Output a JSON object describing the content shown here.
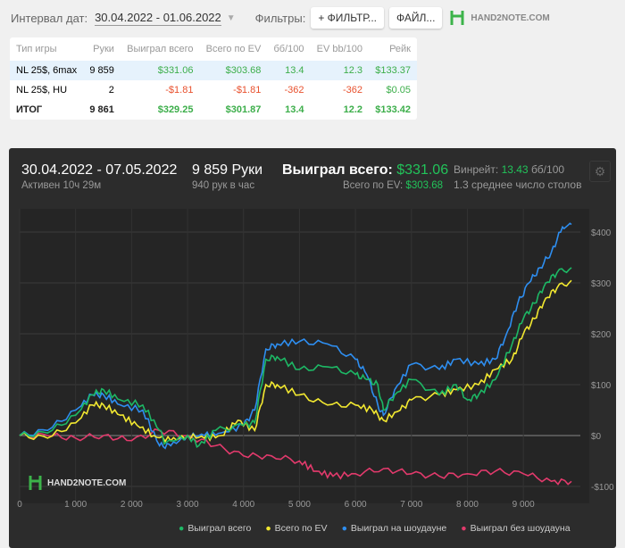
{
  "toolbar": {
    "interval_label": "Интервал дат:",
    "date_range": "30.04.2022 - 01.06.2022",
    "filters_label": "Фильтры:",
    "filter_button": "+ ФИЛЬТР...",
    "file_button": "ФАЙЛ...",
    "logo_text": "HAND2NOTE.COM"
  },
  "table": {
    "headers": [
      "Тип игры",
      "Руки",
      "Выиграл всего",
      "Всего по EV",
      "бб/100",
      "EV bb/100",
      "Рейк"
    ],
    "rows": [
      [
        "NL 25$, 6max",
        "9 859",
        "$331.06",
        "$303.68",
        "13.4",
        "12.3",
        "$133.37"
      ],
      [
        "NL 25$, HU",
        "2",
        "-$1.81",
        "-$1.81",
        "-362",
        "-362",
        "$0.05"
      ],
      [
        "ИТОГ",
        "9 861",
        "$329.25",
        "$301.87",
        "13.4",
        "12.2",
        "$133.42"
      ]
    ]
  },
  "summary": {
    "period": "30.04.2022 - 07.05.2022",
    "active": "Активен 10ч 29м",
    "hands": "9 859 Руки",
    "hands_per_hour": "940 рук в час",
    "won_label": "Выиграл всего:",
    "won_value": "$331.06",
    "ev_label": "Всего по EV:",
    "ev_value": "$303.68",
    "winrate_label": "Винрейт:",
    "winrate_value": "13.43",
    "winrate_unit": "бб/100",
    "tables": "1.3 среднее число столов",
    "watermark": "HAND2NOTE.COM"
  },
  "chart_data": {
    "type": "line",
    "xlim": [
      0,
      9859
    ],
    "ylim": [
      -120,
      440
    ],
    "x_ticks": [
      0,
      1000,
      2000,
      3000,
      4000,
      5000,
      6000,
      7000,
      8000,
      9000
    ],
    "x_tick_labels": [
      "0",
      "1 000",
      "2 000",
      "3 000",
      "4 000",
      "5 000",
      "6 000",
      "7 000",
      "8 000",
      "9 000"
    ],
    "y_ticks": [
      -100,
      0,
      100,
      200,
      300,
      400
    ],
    "y_tick_labels": [
      "-$100",
      "$0",
      "$100",
      "$200",
      "$300",
      "$400"
    ],
    "legend_position": "bottom",
    "series": [
      {
        "name": "Выиграл всего",
        "color": "#1db865",
        "points": [
          [
            0,
            0
          ],
          [
            500,
            5
          ],
          [
            1000,
            40
          ],
          [
            1300,
            80
          ],
          [
            1500,
            90
          ],
          [
            1800,
            70
          ],
          [
            2200,
            60
          ],
          [
            2500,
            10
          ],
          [
            2600,
            -15
          ],
          [
            3000,
            0
          ],
          [
            3200,
            -20
          ],
          [
            3500,
            10
          ],
          [
            4000,
            20
          ],
          [
            4200,
            25
          ],
          [
            4400,
            150
          ],
          [
            4600,
            155
          ],
          [
            5000,
            130
          ],
          [
            5500,
            135
          ],
          [
            6000,
            120
          ],
          [
            6200,
            110
          ],
          [
            6400,
            100
          ],
          [
            6500,
            50
          ],
          [
            6700,
            80
          ],
          [
            7000,
            110
          ],
          [
            7500,
            80
          ],
          [
            7800,
            100
          ],
          [
            8000,
            70
          ],
          [
            8200,
            80
          ],
          [
            8500,
            110
          ],
          [
            8800,
            180
          ],
          [
            9000,
            230
          ],
          [
            9200,
            260
          ],
          [
            9400,
            300
          ],
          [
            9600,
            320
          ],
          [
            9859,
            330
          ]
        ]
      },
      {
        "name": "Всего по EV",
        "color": "#f2e830",
        "points": [
          [
            0,
            0
          ],
          [
            500,
            -5
          ],
          [
            1000,
            25
          ],
          [
            1300,
            60
          ],
          [
            1500,
            60
          ],
          [
            1800,
            40
          ],
          [
            2100,
            20
          ],
          [
            2400,
            0
          ],
          [
            2700,
            -10
          ],
          [
            3000,
            0
          ],
          [
            3300,
            -5
          ],
          [
            3600,
            0
          ],
          [
            3900,
            30
          ],
          [
            4200,
            10
          ],
          [
            4400,
            100
          ],
          [
            4600,
            100
          ],
          [
            5000,
            80
          ],
          [
            5500,
            60
          ],
          [
            6000,
            60
          ],
          [
            6300,
            50
          ],
          [
            6500,
            30
          ],
          [
            6800,
            50
          ],
          [
            7000,
            70
          ],
          [
            7500,
            80
          ],
          [
            7800,
            90
          ],
          [
            8200,
            100
          ],
          [
            8500,
            130
          ],
          [
            8800,
            150
          ],
          [
            9000,
            200
          ],
          [
            9200,
            230
          ],
          [
            9400,
            270
          ],
          [
            9600,
            290
          ],
          [
            9859,
            305
          ]
        ]
      },
      {
        "name": "Выиграл на шоудауне",
        "color": "#2e8ef0",
        "points": [
          [
            0,
            0
          ],
          [
            500,
            10
          ],
          [
            1000,
            50
          ],
          [
            1300,
            80
          ],
          [
            1500,
            80
          ],
          [
            1800,
            60
          ],
          [
            2200,
            50
          ],
          [
            2500,
            -20
          ],
          [
            2700,
            -20
          ],
          [
            3000,
            0
          ],
          [
            3300,
            0
          ],
          [
            3600,
            5
          ],
          [
            4000,
            20
          ],
          [
            4200,
            50
          ],
          [
            4400,
            170
          ],
          [
            4600,
            180
          ],
          [
            5000,
            185
          ],
          [
            5500,
            180
          ],
          [
            6000,
            150
          ],
          [
            6200,
            120
          ],
          [
            6400,
            60
          ],
          [
            6500,
            40
          ],
          [
            6700,
            90
          ],
          [
            7000,
            140
          ],
          [
            7500,
            130
          ],
          [
            7800,
            150
          ],
          [
            8200,
            140
          ],
          [
            8500,
            150
          ],
          [
            8700,
            200
          ],
          [
            8900,
            260
          ],
          [
            9100,
            300
          ],
          [
            9300,
            330
          ],
          [
            9500,
            360
          ],
          [
            9700,
            410
          ],
          [
            9859,
            415
          ]
        ]
      },
      {
        "name": "Выиграл без шоудауна",
        "color": "#e23a6c",
        "points": [
          [
            0,
            0
          ],
          [
            500,
            0
          ],
          [
            1000,
            -5
          ],
          [
            1500,
            0
          ],
          [
            2000,
            -10
          ],
          [
            2500,
            10
          ],
          [
            3000,
            0
          ],
          [
            3500,
            -20
          ],
          [
            4000,
            -40
          ],
          [
            4500,
            -40
          ],
          [
            5000,
            -50
          ],
          [
            5300,
            -70
          ],
          [
            5600,
            -80
          ],
          [
            6000,
            -75
          ],
          [
            6500,
            -65
          ],
          [
            7000,
            -75
          ],
          [
            7500,
            -80
          ],
          [
            8000,
            -75
          ],
          [
            8500,
            -70
          ],
          [
            9000,
            -75
          ],
          [
            9500,
            -90
          ],
          [
            9859,
            -90
          ]
        ]
      }
    ]
  }
}
